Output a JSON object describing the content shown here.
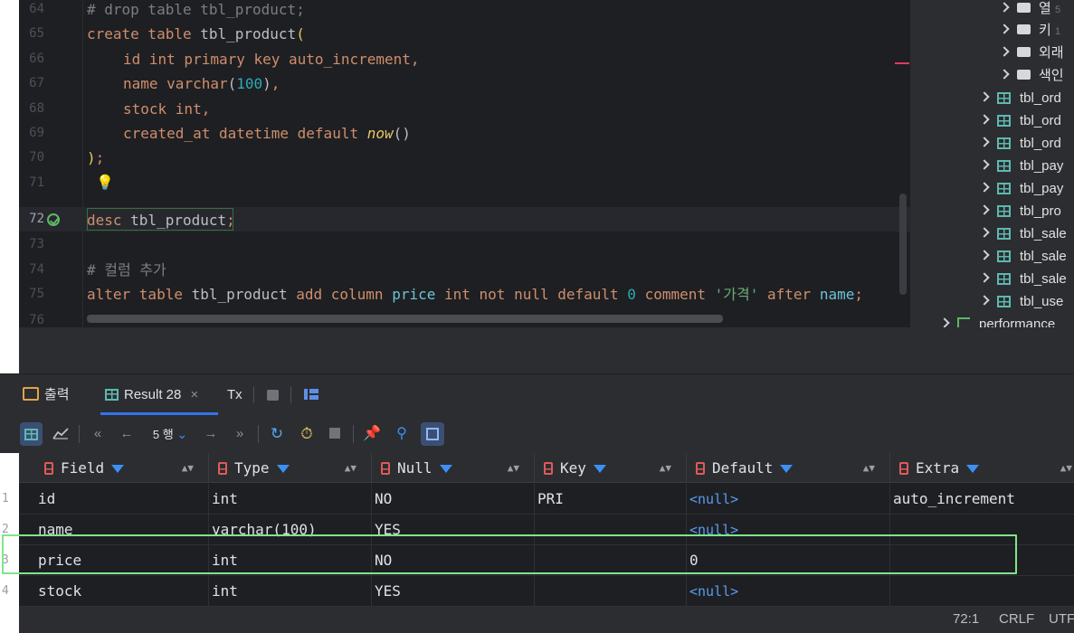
{
  "editor": {
    "lines": [
      {
        "n": "64"
      },
      {
        "n": "65"
      },
      {
        "n": "66"
      },
      {
        "n": "67"
      },
      {
        "n": "68"
      },
      {
        "n": "69"
      },
      {
        "n": "70"
      },
      {
        "n": "71"
      },
      {
        "n": "72"
      },
      {
        "n": "73"
      },
      {
        "n": "74"
      },
      {
        "n": "75"
      },
      {
        "n": "76"
      }
    ],
    "code": {
      "l64": "# drop table tbl_product;",
      "l65_kw": "create table",
      "l65_id": "tbl_product",
      "l66_kw1": "id int primary key auto_increment",
      "l67_name": "name",
      "l67_type": "varchar",
      "l67_num": "100",
      "l68_kw": "stock int",
      "l69_kw": "created_at datetime default",
      "l69_fn": "now",
      "l72_kw": "desc",
      "l72_id": "tbl_product",
      "l74": "# 컬럼 추가",
      "l75_kw1": "alter table",
      "l75_id": "tbl_product",
      "l75_kw2": "add column",
      "l75_col": "price",
      "l75_kw3": "int not null default",
      "l75_num": "0",
      "l75_kw4": "comment",
      "l75_str": "'가격'",
      "l75_kw5": "after",
      "l75_name": "name"
    }
  },
  "tree": {
    "folders": [
      {
        "label": "열",
        "count": "5"
      },
      {
        "label": "키",
        "count": "1"
      },
      {
        "label": "외래"
      },
      {
        "label": "색인"
      }
    ],
    "tables": [
      "tbl_ord",
      "tbl_ord",
      "tbl_ord",
      "tbl_pay",
      "tbl_pay",
      "tbl_pro",
      "tbl_sale",
      "tbl_sale",
      "tbl_sale",
      "tbl_use"
    ],
    "schema": "performance"
  },
  "tabs": {
    "output": "출력",
    "result": "Result 28",
    "close": "×",
    "tx": "Tx"
  },
  "toolbar": {
    "rows_count": "5",
    "rows_unit": "행"
  },
  "grid": {
    "columns": [
      "Field",
      "Type",
      "Null",
      "Key",
      "Default",
      "Extra"
    ],
    "rows": [
      {
        "num": "1",
        "field": "id",
        "type": "int",
        "null": "NO",
        "key": "PRI",
        "default": "<null>",
        "extra": "auto_increment"
      },
      {
        "num": "2",
        "field": "name",
        "type": "varchar(100)",
        "null": "YES",
        "key": "",
        "default": "<null>",
        "extra": ""
      },
      {
        "num": "3",
        "field": "price",
        "type": "int",
        "null": "NO",
        "key": "",
        "default": "0",
        "extra": ""
      },
      {
        "num": "4",
        "field": "stock",
        "type": "int",
        "null": "YES",
        "key": "",
        "default": "<null>",
        "extra": ""
      }
    ]
  },
  "status": {
    "position": "72:1",
    "line_ending": "CRLF",
    "encoding": "UTF"
  },
  "colors": {
    "keyword": "#cf8e6d",
    "number": "#2aacb8",
    "null": "#5a9cf0",
    "highlight": "#7fe58a"
  }
}
